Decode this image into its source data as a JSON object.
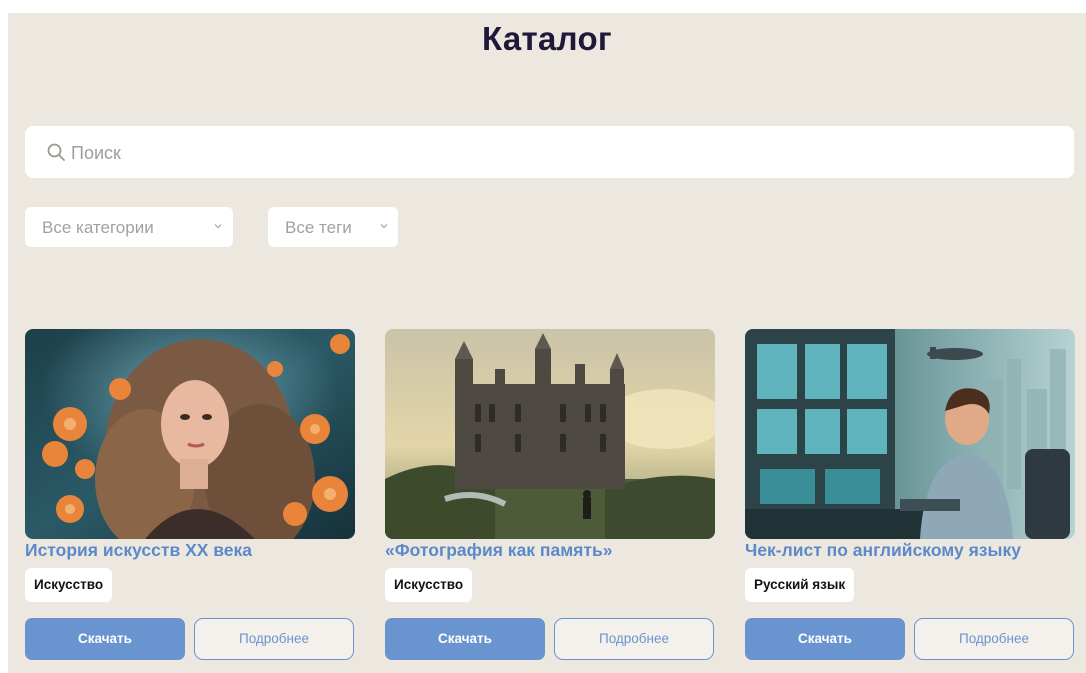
{
  "header": {
    "title": "Каталог"
  },
  "search": {
    "placeholder": "Поиск",
    "icon": "search-icon"
  },
  "filters": {
    "category": {
      "selected": "Все категории",
      "icon": "chevron-down-icon"
    },
    "tags": {
      "selected": "Все теги",
      "icon": "chevron-down-icon"
    }
  },
  "colors": {
    "background": "#ede8df",
    "title": "#1f1838",
    "accent": "#6a94cf",
    "card_title": "#5b89c9"
  },
  "cards": [
    {
      "title": "История искусств XX века",
      "tag": "Искусство",
      "download_label": "Скачать",
      "more_label": "Подробнее",
      "image": "woman-with-flowers-illustration"
    },
    {
      "title": "«Фотография как память»",
      "tag": "Искусство",
      "download_label": "Скачать",
      "more_label": "Подробнее",
      "image": "gothic-castle-landscape-illustration"
    },
    {
      "title": "Чек-лист по английскому языку",
      "tag": "Русский язык",
      "download_label": "Скачать",
      "more_label": "Подробнее",
      "image": "man-at-computer-illustration"
    }
  ]
}
